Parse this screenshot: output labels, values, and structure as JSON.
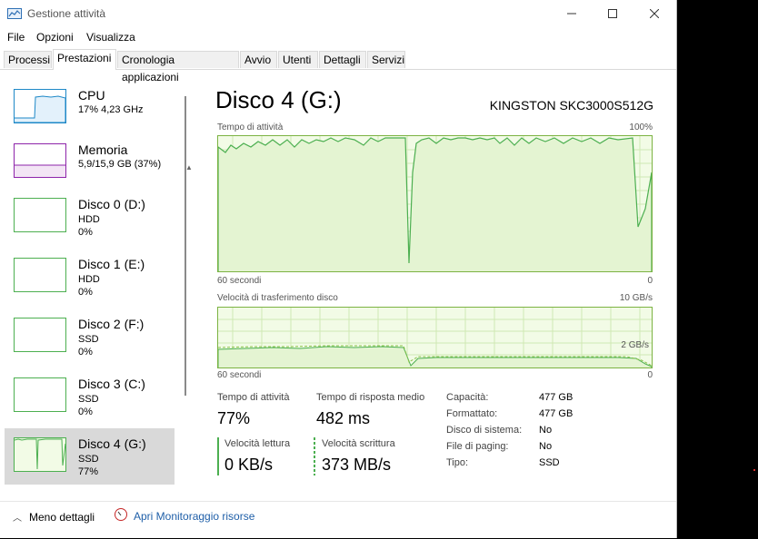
{
  "window": {
    "title": "Gestione attività"
  },
  "menu": [
    "File",
    "Opzioni",
    "Visualizza"
  ],
  "tabs": [
    "Processi",
    "Prestazioni",
    "Cronologia applicazioni",
    "Avvio",
    "Utenti",
    "Dettagli",
    "Servizi"
  ],
  "active_tab": "Prestazioni",
  "sidebar": [
    {
      "name": "CPU",
      "line1": "17% 4,23 GHz",
      "line2": "",
      "color": "#1e88c7"
    },
    {
      "name": "Memoria",
      "line1": "5,9/15,9 GB (37%)",
      "line2": "",
      "color": "#8e24aa"
    },
    {
      "name": "Disco 0 (D:)",
      "line1": "HDD",
      "line2": "0%",
      "color": "#4caf50"
    },
    {
      "name": "Disco 1 (E:)",
      "line1": "HDD",
      "line2": "0%",
      "color": "#4caf50"
    },
    {
      "name": "Disco 2 (F:)",
      "line1": "SSD",
      "line2": "0%",
      "color": "#4caf50"
    },
    {
      "name": "Disco 3 (C:)",
      "line1": "SSD",
      "line2": "0%",
      "color": "#4caf50"
    },
    {
      "name": "Disco 4 (G:)",
      "line1": "SSD",
      "line2": "77%",
      "color": "#4caf50"
    }
  ],
  "main": {
    "title": "Disco 4 (G:)",
    "model": "KINGSTON SKC3000S512G",
    "graph1": {
      "label": "Tempo di attività",
      "max": "100%",
      "xlabel": "60 secondi",
      "min": "0"
    },
    "graph2": {
      "label": "Velocità di trasferimento disco",
      "max": "10 GB/s",
      "mid": "2 GB/s",
      "xlabel": "60 secondi",
      "min": "0"
    },
    "stats": {
      "active_label": "Tempo di attività",
      "active_value": "77%",
      "resp_label": "Tempo di risposta medio",
      "resp_value": "482 ms",
      "read_label": "Velocità lettura",
      "read_value": "0 KB/s",
      "write_label": "Velocità scrittura",
      "write_value": "373 MB/s"
    },
    "props": [
      {
        "k": "Capacità:",
        "v": "477 GB"
      },
      {
        "k": "Formattato:",
        "v": "477 GB"
      },
      {
        "k": "Disco di sistema:",
        "v": "No"
      },
      {
        "k": "File di paging:",
        "v": "No"
      },
      {
        "k": "Tipo:",
        "v": "SSD"
      }
    ]
  },
  "footer": {
    "fewer": "Meno dettagli",
    "monitor": "Apri Monitoraggio risorse"
  },
  "colors": {
    "disk_green": "#4caf50",
    "link_blue": "#1f5fa8"
  }
}
